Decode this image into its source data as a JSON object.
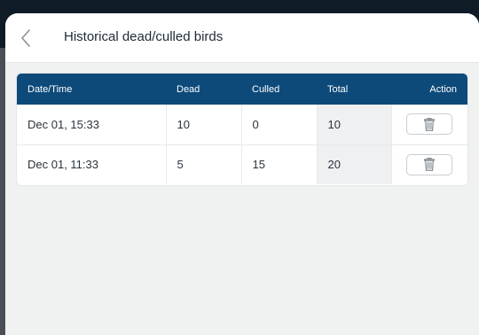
{
  "modal": {
    "title": "Historical dead/culled birds",
    "back_icon": "chevron-left-icon"
  },
  "table": {
    "headers": {
      "datetime": "Date/Time",
      "dead": "Dead",
      "culled": "Culled",
      "total": "Total",
      "action": "Action"
    },
    "rows": [
      {
        "datetime": "Dec 01, 15:33",
        "dead": "10",
        "culled": "0",
        "total": "10",
        "action_icon": "trash-icon"
      },
      {
        "datetime": "Dec 01, 11:33",
        "dead": "5",
        "culled": "15",
        "total": "20",
        "action_icon": "trash-icon"
      }
    ]
  },
  "colors": {
    "header_bg": "#0d4a7a",
    "backdrop": "#f0f1f1"
  }
}
